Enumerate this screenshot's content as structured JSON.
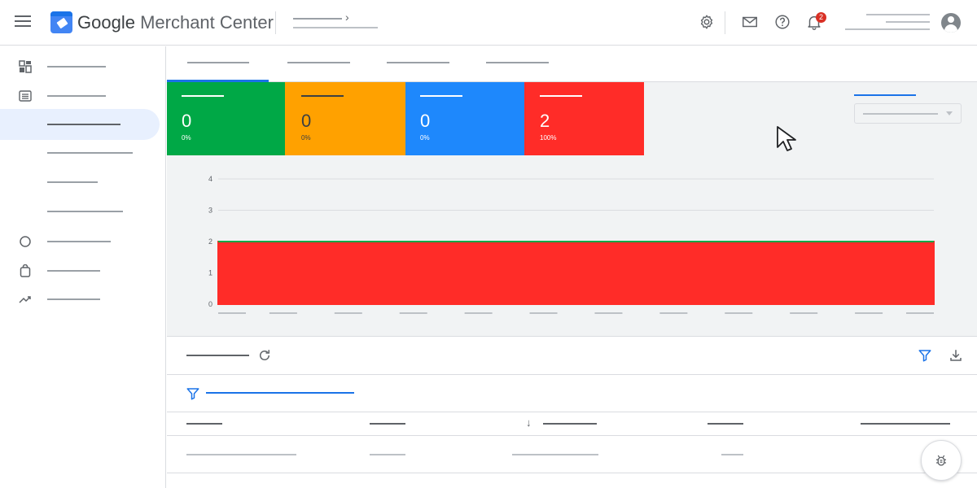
{
  "header": {
    "app_title_brand": "Google",
    "app_title_product": " Merchant Center",
    "breadcrumb_arrow": "›",
    "notification_count": "2",
    "icons": [
      "menu-icon",
      "merchant-center-logo",
      "gear-icon",
      "mail-icon",
      "help-icon",
      "bell-icon",
      "avatar-icon"
    ]
  },
  "sidebar": {
    "items": [
      {
        "icon": "dashboard-icon"
      },
      {
        "icon": "list-icon"
      },
      {
        "icon": "none",
        "active": true
      },
      {
        "icon": "none"
      },
      {
        "icon": "none"
      },
      {
        "icon": "none"
      },
      {
        "icon": "circle-icon"
      },
      {
        "icon": "bag-icon"
      },
      {
        "icon": "trending-icon"
      }
    ]
  },
  "scorecards": [
    {
      "value": "0",
      "percent": "0%",
      "color": "#00a846"
    },
    {
      "value": "0",
      "percent": "0%",
      "color": "#ffa100"
    },
    {
      "value": "0",
      "percent": "0%",
      "color": "#1e88fc"
    },
    {
      "value": "2",
      "percent": "100%",
      "color": "#ff2c28"
    }
  ],
  "chart_data": {
    "type": "area",
    "y_ticks": [
      "4",
      "3",
      "2",
      "1",
      "0"
    ],
    "ylim": [
      0,
      4
    ],
    "x_points": 12,
    "series": [
      {
        "values": [
          2,
          2,
          2,
          2,
          2,
          2,
          2,
          2,
          2,
          2,
          2,
          2
        ],
        "color": "#ff2c28"
      },
      {
        "values": [
          0,
          0,
          0,
          0,
          0,
          0,
          0,
          0,
          0,
          0,
          0,
          0
        ],
        "color": "#00a846"
      }
    ],
    "grid": true
  },
  "colors": {
    "accent": "#1a73e8",
    "overview_bg": "#f1f3f4",
    "notification": "#d93025"
  },
  "table": {
    "toolbar_icons": [
      "refresh-icon",
      "filter-icon",
      "download-icon"
    ],
    "sort_indicator": "↓"
  }
}
